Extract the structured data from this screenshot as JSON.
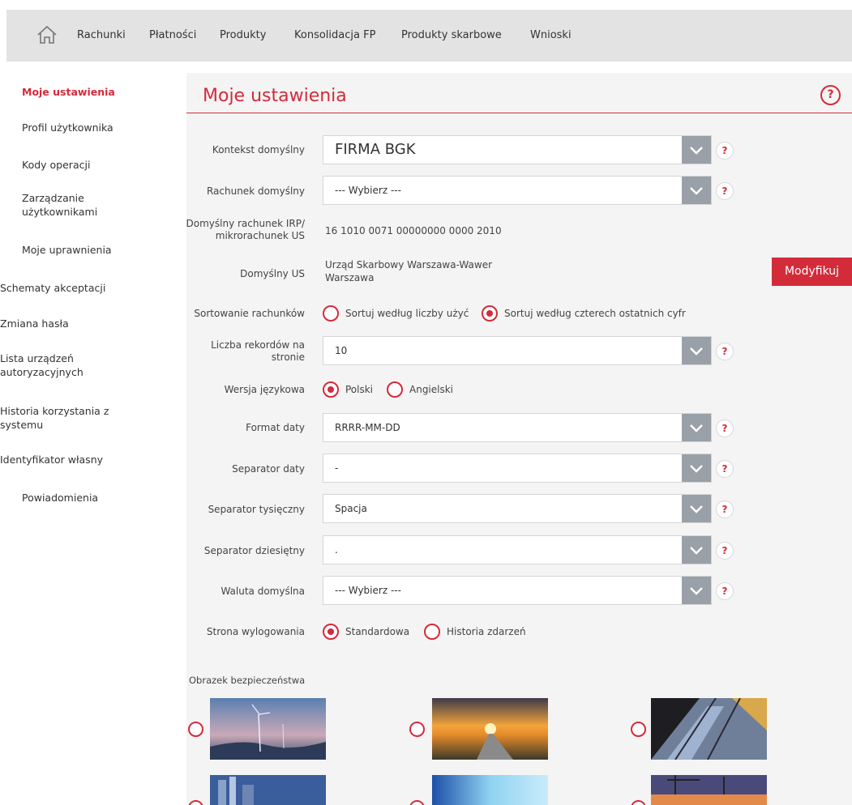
{
  "nav": {
    "items": [
      "Rachunki",
      "Płatności",
      "Produkty",
      "Konsolidacja FP",
      "Produkty skarbowe",
      "Wnioski"
    ]
  },
  "sidebar": {
    "items": [
      {
        "label": "Moje ustawienia",
        "active": true
      },
      {
        "label": "Profil użytkownika"
      },
      {
        "label": "Kody operacji"
      },
      {
        "label": "Zarządzanie użytkownikami"
      },
      {
        "label": "Moje uprawnienia"
      },
      {
        "label": "Schematy akceptacji"
      },
      {
        "label": "Zmiana hasła"
      },
      {
        "label": "Lista urządzeń autoryzacyjnych"
      },
      {
        "label": "Historia korzystania z systemu"
      },
      {
        "label": "Identyfikator własny"
      },
      {
        "label": "Powiadomienia"
      }
    ]
  },
  "main": {
    "title": "Moje ustawienia",
    "help": "?",
    "modify_label": "Modyfikuj",
    "fields": {
      "context": {
        "label": "Kontekst domyślny",
        "value": "FIRMA BGK"
      },
      "account": {
        "label": "Rachunek domyślny",
        "value": "--- Wybierz ---"
      },
      "irp": {
        "label": "Domyślny rachunek IRP/ mikrorachunek US",
        "value": "16 1010 0071 00000000 0000 2010"
      },
      "us": {
        "label": "Domyślny US",
        "value_line1": "Urząd Skarbowy Warszawa-Wawer",
        "value_line2": "Warszawa"
      },
      "sort": {
        "label": "Sortowanie rachunków",
        "options": [
          "Sortuj według liczby użyć",
          "Sortuj według czterech ostatnich cyfr"
        ],
        "selected": 1
      },
      "records": {
        "label": "Liczba rekordów na stronie",
        "value": "10"
      },
      "lang": {
        "label": "Wersja językowa",
        "options": [
          "Polski",
          "Angielski"
        ],
        "selected": 0
      },
      "date_format": {
        "label": "Format daty",
        "value": "RRRR-MM-DD"
      },
      "date_sep": {
        "label": "Separator daty",
        "value": "-"
      },
      "thousand_sep": {
        "label": "Separator tysięczny",
        "value": "Spacja"
      },
      "decimal_sep": {
        "label": "Separator dziesiętny",
        "value": "."
      },
      "currency": {
        "label": "Waluta domyślna",
        "value": "--- Wybierz ---"
      },
      "logout": {
        "label": "Strona wylogowania",
        "options": [
          "Standardowa",
          "Historia zdarzeń"
        ],
        "selected": 0
      }
    },
    "security_image_label": "Obrazek bezpieczeństwa"
  },
  "colors": {
    "accent": "#d42b3a",
    "nav_bg": "#e3e3e3",
    "panel_bg": "#f4f4f4",
    "select_arrow_bg": "#9aa0a8"
  }
}
